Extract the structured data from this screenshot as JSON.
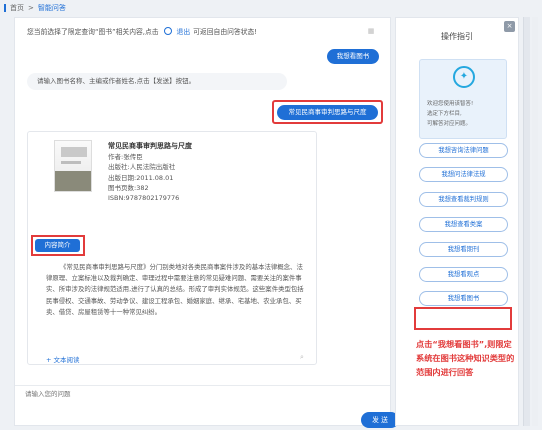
{
  "breadcrumb": {
    "home": "首页",
    "sep": ">",
    "current": "智能问答"
  },
  "notice": {
    "pre": "您当前选择了限定查询“图书”相关内容,点击",
    "link": "退出",
    "post": "可返回自由问答状态!"
  },
  "top_pill": "我想看图书",
  "prompt": "请输入图书名称、主编或作者姓名,点击【发送】按钮。",
  "user_question": "常见民商事审判思路与尺度",
  "book": {
    "title": "常见民商事审判思路与尺度",
    "author": "作者:张传臣",
    "publisher": "出版社:人民法院出版社",
    "date": "出版日期:2011.08.01",
    "pages": "图书页数:382",
    "isbn": "ISBN:9787802179776",
    "intro_label": "内容简介",
    "description": "《常见民商事审判思路与尺度》分门别类地对各类民商事案件涉及的基本法律概念、法律原理、立案标准以及裁判确定、审理过程中需要注意的常见疑难问题、需要关注的案件事实、所审涉及的法律规范适用,进行了认真的总结。形成了审判实体规范。这些案件类型包括民事侵权、交通事故、劳动争议、建设工程承包、婚姻家庭、继承、宅基地、农业承包、买卖、借贷、房屋租赁等十一种常见纠纷。",
    "read_label": "+ 文本阅读"
  },
  "input": {
    "placeholder": "请输入您的问题"
  },
  "send_label": "发 送",
  "sidebar": {
    "title": "操作指引",
    "guide": [
      "欢迎您使用该智答!",
      "选定下方栏目,",
      "可解答对应问题。"
    ],
    "buttons": [
      "我想咨询法律问题",
      "我想问法律法规",
      "我想查看裁判规则",
      "我想查看类案",
      "我想看期刊",
      "我想看观点",
      "我想看图书"
    ],
    "annotation": "点击“我想看图书”,则限定系统在图书这种知识类型的范围内进行回答"
  },
  "colors": {
    "accent": "#1f6fd6",
    "highlight": "#e23b3b"
  }
}
